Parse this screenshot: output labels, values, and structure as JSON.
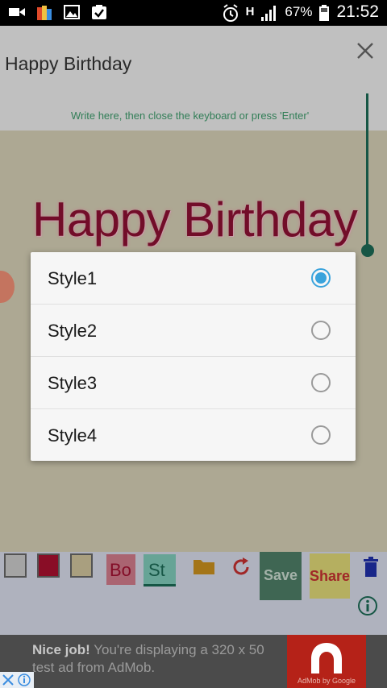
{
  "status_bar": {
    "battery": "67%",
    "time": "21:52",
    "network": "H",
    "left_icons": [
      "video-icon",
      "app-icon",
      "image-icon",
      "clipboard-check-icon"
    ],
    "right_icons": [
      "alarm-icon",
      "network-h-icon",
      "signal-icon",
      "battery-icon"
    ]
  },
  "header": {
    "title": "Happy Birthday",
    "hint": "Write here, then close the keyboard or press 'Enter'"
  },
  "canvas": {
    "text": "Happy Birthday",
    "text_color": "#8c1033"
  },
  "dialog": {
    "options": [
      {
        "label": "Style1",
        "checked": true
      },
      {
        "label": "Style2",
        "checked": false
      },
      {
        "label": "Style3",
        "checked": false
      },
      {
        "label": "Style4",
        "checked": false
      }
    ]
  },
  "toolbar": {
    "swatches": [
      "#c8c8c8",
      "#a8102f",
      "#cfc39c"
    ],
    "bold_label": "Bo",
    "style_label": "St",
    "save_label": "Save",
    "share_label": "Share"
  },
  "ad": {
    "headline": "Nice job!",
    "body": "You're displaying a 320 x 50 test ad from AdMob.",
    "logo_caption": "AdMob by Google"
  },
  "colors": {
    "accent": "#3aa3dc",
    "slider": "#1c6a55"
  }
}
